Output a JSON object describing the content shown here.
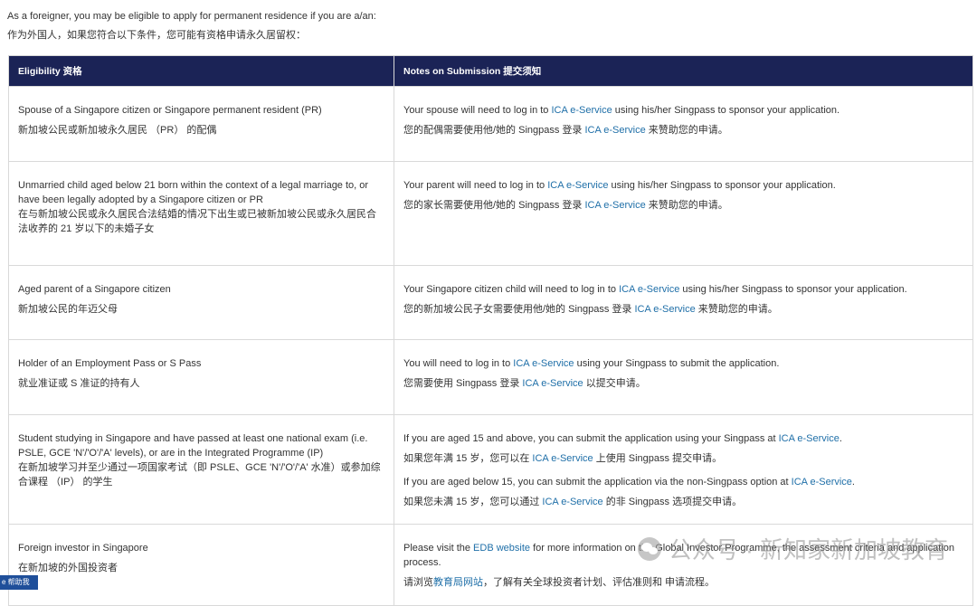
{
  "intro": {
    "en": "As a foreigner, you may be eligible to apply for permanent residence if you are a/an:",
    "zh": "作为外国人，如果您符合以下条件，您可能有资格申请永久居留权："
  },
  "table": {
    "headers": [
      "Eligibility  资格",
      "Notes on Submission  提交须知"
    ],
    "rows": [
      {
        "eligibility": [
          "Spouse of a Singapore citizen or Singapore permanent resident (PR)",
          "新加坡公民或新加坡永久居民 （PR） 的配偶"
        ],
        "notes": [
          [
            "Your spouse will need to log in to ",
            "ICA e-Service",
            " using his/her Singpass to sponsor your application."
          ],
          [
            "您的配偶需要使用他/她的 Singpass 登录 ",
            "ICA e-Service",
            " 来赞助您的申请。"
          ]
        ]
      },
      {
        "eligibility": [
          "Unmarried child aged below 21 born within the context of a legal marriage to, or have been legally adopted by a Singapore citizen or PR",
          "在与新加坡公民或永久居民合法结婚的情况下出生或已被新加坡公民或永久居民合法收养的 21 岁以下的未婚子女"
        ],
        "notes": [
          [
            "Your parent will need to log in to ",
            "ICA e-Service",
            " using his/her Singpass to sponsor your application."
          ],
          [
            "您的家长需要使用他/她的 Singpass 登录 ",
            "ICA e-Service",
            " 来赞助您的申请。"
          ]
        ]
      },
      {
        "eligibility": [
          "Aged parent of a Singapore citizen",
          "新加坡公民的年迈父母"
        ],
        "notes": [
          [
            "Your Singapore citizen child will need to log in to ",
            "ICA e-Service",
            " using his/her Singpass to sponsor your application."
          ],
          [
            "您的新加坡公民子女需要使用他/她的 Singpass 登录 ",
            "ICA e-Service",
            " 来赞助您的申请。"
          ]
        ]
      },
      {
        "eligibility": [
          "Holder of an Employment Pass or S Pass",
          "就业准证或 S 准证的持有人"
        ],
        "notes": [
          [
            "You will need to log in to ",
            "ICA e-Service",
            " using your Singpass to submit the application."
          ],
          [
            "您需要使用 Singpass 登录 ",
            "ICA e-Service",
            " 以提交申请。"
          ]
        ]
      },
      {
        "eligibility": [
          "Student studying in Singapore and have passed at least one national exam (i.e. PSLE, GCE 'N'/'O'/'A' levels), or are in the Integrated Programme (IP)",
          "在新加坡学习并至少通过一项国家考试（即 PSLE、GCE 'N'/'O'/'A' 水准）或参加综合课程 （IP） 的学生"
        ],
        "notes": [
          [
            "If you are aged 15 and above, you can submit the application using your Singpass at ",
            "ICA e-Service",
            "."
          ],
          [
            "如果您年满 15 岁，您可以在 ",
            "ICA e-Service",
            " 上使用 Singpass 提交申请。"
          ],
          [
            "If you are aged below 15, you can submit the application via the non-Singpass option at ",
            "ICA e-Service",
            "."
          ],
          [
            "如果您未满 15 岁，您可以通过 ",
            "ICA e-Service",
            " 的非 Singpass 选项提交申请。"
          ]
        ]
      },
      {
        "eligibility": [
          "Foreign investor in Singapore",
          "在新加坡的外国投资者"
        ],
        "notes": [
          [
            "Please visit the ",
            "EDB website",
            " for more information on the Global Investor Programme, the assessment criteria and application process."
          ],
          [
            "请浏览",
            "教育局网站",
            "，了解有关全球投资者计划、评估准则和 申请流程。"
          ]
        ]
      }
    ]
  },
  "watermark": {
    "text": "公众号 · 新知家新加坡教育",
    "icon": "wechat-icon"
  },
  "corner_button": "e 帮助我",
  "colors": {
    "header_bg": "#1b2356",
    "link": "#1f6fa8",
    "border": "#d9d9d9"
  }
}
